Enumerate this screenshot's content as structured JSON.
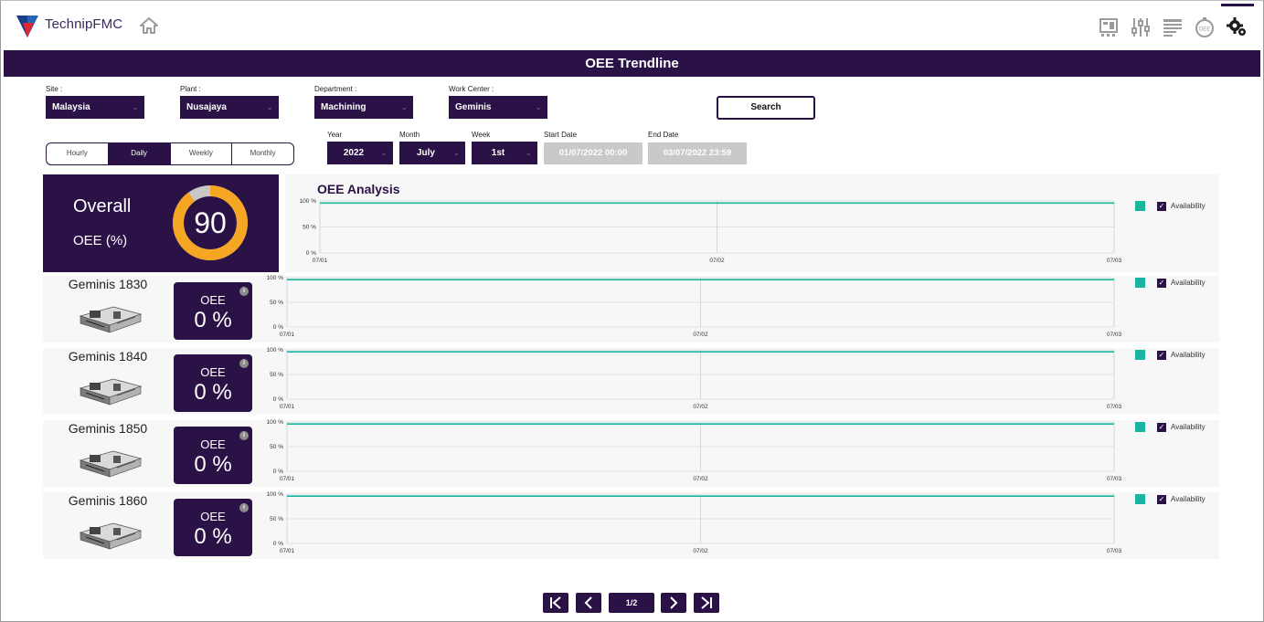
{
  "app": {
    "brand": "TechnipFMC",
    "page_title": "OEE Trendline"
  },
  "header_icons": [
    "dashboard-icon",
    "sliders-icon",
    "report-list-icon",
    "oee-timer-icon",
    "settings-gear-icon"
  ],
  "filters": {
    "site_label": "Site :",
    "site_value": "Malaysia",
    "plant_label": "Plant :",
    "plant_value": "Nusajaya",
    "department_label": "Department :",
    "department_value": "Machining",
    "workcenter_label": "Work Center :",
    "workcenter_value": "Geminis",
    "search_label": "Search",
    "year_label": "Year",
    "year_value": "2022",
    "month_label": "Month",
    "month_value": "July",
    "week_label": "Week",
    "week_value": "1st",
    "start_label": "Start Date",
    "start_value": "01/07/2022 00:00",
    "end_label": "End Date",
    "end_value": "03/07/2022 23:59"
  },
  "granularity": {
    "options": [
      "Hourly",
      "Daily",
      "Weekly",
      "Monthly"
    ],
    "selected": "Daily"
  },
  "overall": {
    "line1": "Overall",
    "line2": "OEE (%)",
    "value": "90",
    "percent": 90
  },
  "analysis_title": "OEE Analysis",
  "legend_label": "Availability",
  "oee_card_label": "OEE",
  "info_glyph": "i",
  "machines": [
    {
      "name": "Geminis 1830",
      "oee": "0 %"
    },
    {
      "name": "Geminis 1840",
      "oee": "0 %"
    },
    {
      "name": "Geminis 1850",
      "oee": "0 %"
    },
    {
      "name": "Geminis 1860",
      "oee": "0 %"
    }
  ],
  "chart_data": [
    {
      "type": "line",
      "title": "OEE Analysis",
      "x": [
        "07/01",
        "07/02",
        "07/03"
      ],
      "y_ticks": [
        "100 %",
        "50 %",
        "0 %"
      ],
      "ylim": [
        0,
        100
      ],
      "series": [
        {
          "name": "Availability",
          "values": [
            96,
            96,
            96
          ]
        }
      ],
      "legend": "right"
    },
    {
      "type": "line",
      "title": "",
      "x": [
        "07/01",
        "07/02",
        "07/03"
      ],
      "y_ticks": [
        "100 %",
        "50 %",
        "0 %"
      ],
      "ylim": [
        0,
        100
      ],
      "series": [
        {
          "name": "Availability",
          "values": [
            96,
            96,
            96
          ]
        }
      ],
      "legend": "right"
    },
    {
      "type": "line",
      "title": "",
      "x": [
        "07/01",
        "07/02",
        "07/03"
      ],
      "y_ticks": [
        "100 %",
        "50 %",
        "0 %"
      ],
      "ylim": [
        0,
        100
      ],
      "series": [
        {
          "name": "Availability",
          "values": [
            96,
            96,
            96
          ]
        }
      ],
      "legend": "right"
    },
    {
      "type": "line",
      "title": "",
      "x": [
        "07/01",
        "07/02",
        "07/03"
      ],
      "y_ticks": [
        "100 %",
        "50 %",
        "0 %"
      ],
      "ylim": [
        0,
        100
      ],
      "series": [
        {
          "name": "Availability",
          "values": [
            96,
            96,
            96
          ]
        }
      ],
      "legend": "right"
    },
    {
      "type": "line",
      "title": "",
      "x": [
        "07/01",
        "07/02",
        "07/03"
      ],
      "y_ticks": [
        "100 %",
        "50 %",
        "0 %"
      ],
      "ylim": [
        0,
        100
      ],
      "series": [
        {
          "name": "Availability",
          "values": [
            96,
            96,
            96
          ]
        }
      ],
      "legend": "right"
    }
  ],
  "pager": {
    "first": "first-page-icon",
    "prev": "previous-page-icon",
    "current": "1/2",
    "next": "next-page-icon",
    "last": "last-page-icon"
  },
  "colors": {
    "primary": "#2a1247",
    "series": "#1ab5a0",
    "gauge": "#f5a623",
    "gauge_rest": "#c8c8c8"
  }
}
